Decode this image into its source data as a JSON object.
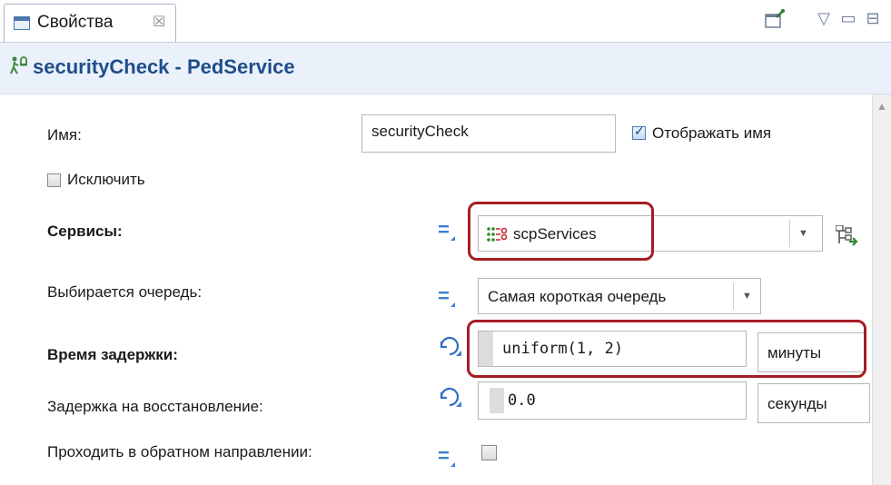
{
  "tab": {
    "label": "Свойства",
    "close": "☒"
  },
  "toolbar": {
    "pin": "📌",
    "menu": "▽",
    "minimize": "▭",
    "maximize": "⊟"
  },
  "title": {
    "icon": "pedestrian-service-icon",
    "text": "securityCheck - PedService"
  },
  "fields": {
    "name_label": "Имя:",
    "name_value": "securityCheck",
    "show_name_label": "Отображать имя",
    "exclude_label": "Исключить",
    "services_label": "Сервисы:",
    "services_value": "scpServices",
    "queue_label": "Выбирается очередь:",
    "queue_value": "Самая короткая очередь",
    "delay_label": "Время задержки:",
    "delay_value": "uniform(1, 2)",
    "delay_unit": "минуты",
    "recovery_label": "Задержка на восстановление:",
    "recovery_value": "0.0",
    "recovery_unit": "секунды",
    "reverse_label": "Проходить в обратном направлении:"
  },
  "states": {
    "show_name_checked": true,
    "exclude_checked": false,
    "reverse_checked": false
  },
  "colors": {
    "highlight": "#a51d24",
    "title_bg": "#eaf1fb",
    "title_text": "#1f4e8a",
    "accent": "#3b7fd1"
  }
}
